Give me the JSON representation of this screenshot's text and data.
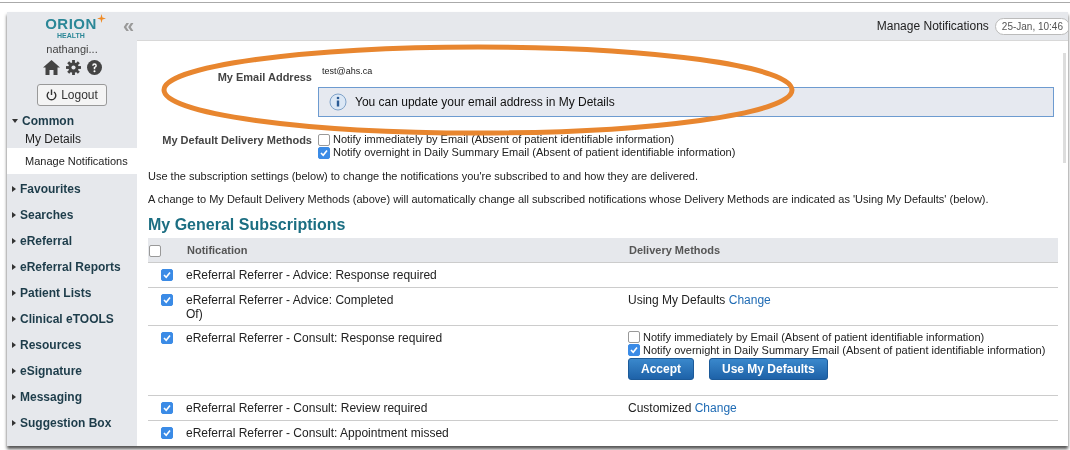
{
  "sidebar": {
    "logo": "ORION",
    "logo_sub": "HEALTH",
    "collapse": "«",
    "user": "nathangi...",
    "logout": "Logout",
    "sections": [
      {
        "label": "Common",
        "expanded": true,
        "children": [
          {
            "label": "My Details",
            "selected": false
          },
          {
            "label": "Manage Notifications",
            "selected": true
          }
        ]
      },
      {
        "label": "Favourites",
        "expanded": false
      },
      {
        "label": "Searches",
        "expanded": false
      },
      {
        "label": "eReferral",
        "expanded": false
      },
      {
        "label": "eReferral Reports",
        "expanded": false
      },
      {
        "label": "Patient Lists",
        "expanded": false
      },
      {
        "label": "Clinical eTOOLS",
        "expanded": false
      },
      {
        "label": "Resources",
        "expanded": false
      },
      {
        "label": "eSignature",
        "expanded": false
      },
      {
        "label": "Messaging",
        "expanded": false
      },
      {
        "label": "Suggestion Box",
        "expanded": false
      }
    ]
  },
  "header": {
    "title": "Manage Notifications",
    "datetime": "25-Jan, 10:46"
  },
  "email": {
    "label": "My Email Address",
    "value": "test@ahs.ca",
    "info": "You can update your email address in My Details"
  },
  "defaults": {
    "label": "My Default Delivery Methods",
    "options": [
      {
        "label": "Notify immediately by Email (Absent of patient identifiable information)",
        "checked": false
      },
      {
        "label": "Notify overnight in Daily Summary Email (Absent of patient identifiable information)",
        "checked": true
      }
    ]
  },
  "intro": [
    "Use the subscription settings (below) to change the notifications you're subscribed to and how they are delivered.",
    "A change to My Default Delivery Methods (above) will automatically change all subscribed notifications whose Delivery Methods are indicated as 'Using My Defaults' (below)."
  ],
  "subscriptions": {
    "title": "My General Subscriptions",
    "all_checked": false,
    "columns": [
      "Notification",
      "Delivery Methods"
    ],
    "rows": [
      {
        "checked": true,
        "notification": "eReferral Referrer - Advice: Response required",
        "delivery": {
          "kind": "none"
        }
      },
      {
        "checked": true,
        "notification": "eReferral Referrer - Advice: Completed",
        "note": "Of)",
        "delivery": {
          "kind": "status",
          "text": "Using My Defaults",
          "link": "Change"
        }
      },
      {
        "checked": true,
        "notification": "eReferral Referrer - Consult: Response required",
        "delivery": {
          "kind": "edit",
          "options": [
            {
              "label": "Notify immediately by Email (Absent of patient identifiable information)",
              "checked": false
            },
            {
              "label": "Notify overnight in Daily Summary Email (Absent of patient identifiable information)",
              "checked": true
            }
          ],
          "buttons": [
            "Accept",
            "Use My Defaults"
          ]
        }
      },
      {
        "checked": true,
        "notification": "eReferral Referrer - Consult: Review required",
        "delivery": {
          "kind": "status",
          "text": "Customized",
          "link": "Change"
        }
      },
      {
        "checked": true,
        "notification": "eReferral Referrer - Consult: Appointment missed",
        "delivery": {
          "kind": "none"
        }
      }
    ]
  }
}
